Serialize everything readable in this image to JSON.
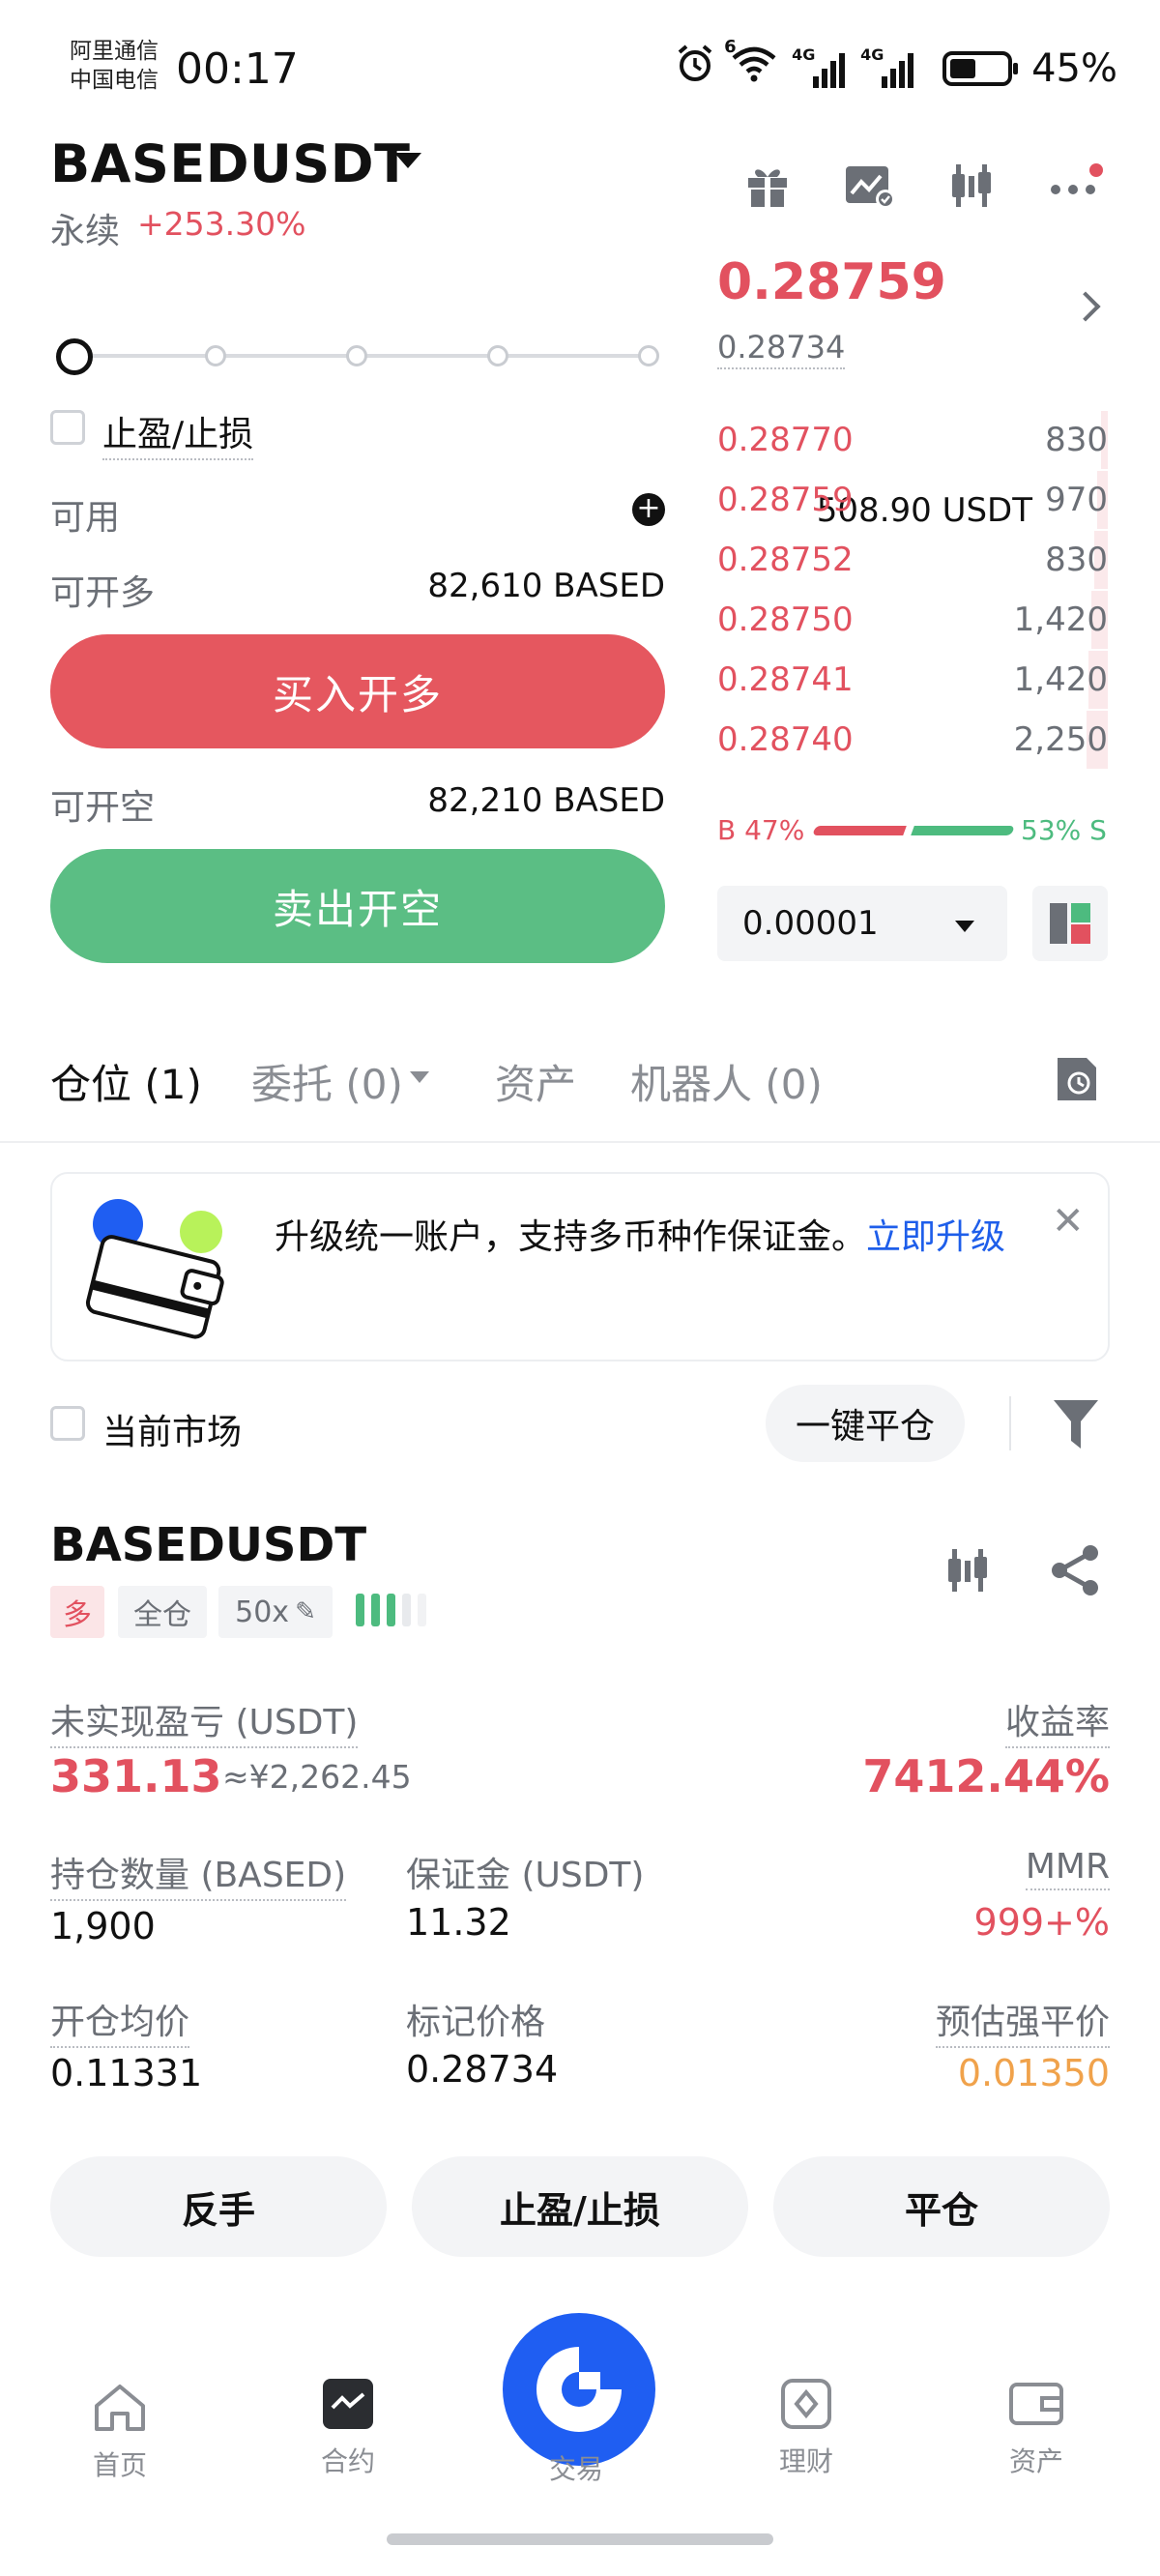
{
  "status_bar": {
    "carrier_1": "阿里通信",
    "carrier_2": "中国电信",
    "time": "00:17",
    "net_1": "4G",
    "net_2": "4G",
    "wifi_badge": "6",
    "battery": "45%"
  },
  "header": {
    "symbol": "BASEDUSDT",
    "contract_type": "永续",
    "change_pct": "+253.30%"
  },
  "order_form": {
    "tpsl_label": "止盈/止损",
    "available_label": "可用",
    "available_value": "508.90 USDT",
    "can_long_label": "可开多",
    "can_long_value": "82,610 BASED",
    "buy_button": "买入开多",
    "can_short_label": "可开空",
    "can_short_value": "82,210 BASED",
    "sell_button": "卖出开空",
    "slider_level_pct": 0
  },
  "order_book": {
    "last_price": "0.28759",
    "mark_price": "0.28734",
    "asks": [
      {
        "price": "0.28770",
        "qty": "830",
        "depth": 0.05
      },
      {
        "price": "0.28759",
        "qty": "970",
        "depth": 0.08
      },
      {
        "price": "0.28752",
        "qty": "830",
        "depth": 0.1
      },
      {
        "price": "0.28750",
        "qty": "1,420",
        "depth": 0.12
      },
      {
        "price": "0.28741",
        "qty": "1,420",
        "depth": 0.14
      },
      {
        "price": "0.28740",
        "qty": "2,250",
        "depth": 0.16
      }
    ],
    "buy_ratio": "B 47%",
    "sell_ratio": "53% S",
    "precision": "0.00001"
  },
  "tabs": {
    "positions": "仓位 (1)",
    "orders": "委托 (0)",
    "assets": "资产",
    "bots": "机器人 (0)"
  },
  "banner": {
    "text": "升级统一账户，支持多币种作保证金。",
    "link": "立即升级"
  },
  "filter": {
    "current_market": "当前市场",
    "close_all": "一键平仓"
  },
  "position": {
    "symbol": "BASEDUSDT",
    "side": "多",
    "margin_mode": "全仓",
    "leverage": "50x",
    "unrealized_label": "未实现盈亏 (USDT)",
    "unrealized_value": "331.13",
    "unrealized_cny": "≈¥2,262.45",
    "roi_label": "收益率",
    "roi_value": "7412.44%",
    "size_label": "持仓数量 (BASED)",
    "size_value": "1,900",
    "margin_label": "保证金 (USDT)",
    "margin_value": "11.32",
    "mmr_label": "MMR",
    "mmr_value": "999+%",
    "entry_label": "开仓均价",
    "entry_value": "0.11331",
    "mark_label": "标记价格",
    "mark_value": "0.28734",
    "liq_label": "预估强平价",
    "liq_value": "0.01350",
    "btn_reverse": "反手",
    "btn_tpsl": "止盈/止损",
    "btn_close": "平仓"
  },
  "bottom_nav": {
    "home": "首页",
    "futures": "合约",
    "trade": "交易",
    "earn": "理财",
    "assets": "资产"
  },
  "colors": {
    "up": "#e2515f",
    "down": "#4dbb7f",
    "accent": "#1f5ef2",
    "warning": "#f0a24b"
  }
}
